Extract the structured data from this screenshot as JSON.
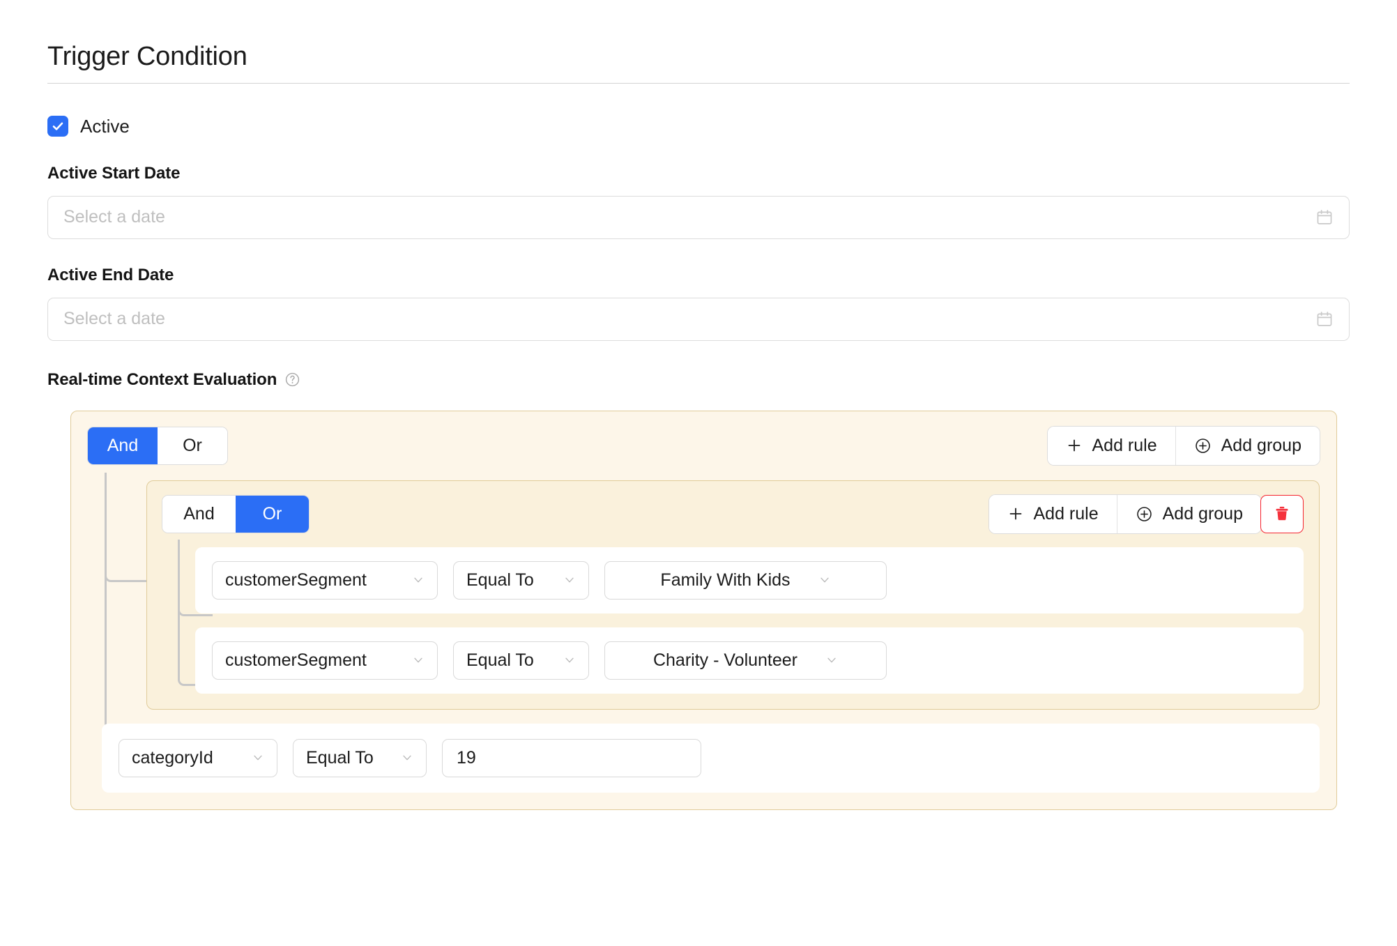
{
  "header": {
    "title": "Trigger Condition"
  },
  "active": {
    "label": "Active",
    "checked": true
  },
  "start_date": {
    "label": "Active Start Date",
    "placeholder": "Select a date",
    "value": ""
  },
  "end_date": {
    "label": "Active End Date",
    "placeholder": "Select a date",
    "value": ""
  },
  "rtce": {
    "label": "Real-time Context Evaluation",
    "help_icon": "question-circle-icon"
  },
  "builder": {
    "outer_group": {
      "combinator": {
        "and_label": "And",
        "or_label": "Or",
        "selected": "And"
      },
      "add_rule_label": "Add rule",
      "add_group_label": "Add group",
      "add_rule_icon": "plus-icon",
      "add_group_icon": "plus-circle-icon"
    },
    "inner_group": {
      "combinator": {
        "and_label": "And",
        "or_label": "Or",
        "selected": "Or"
      },
      "add_rule_label": "Add rule",
      "add_group_label": "Add group",
      "add_rule_icon": "plus-icon",
      "add_group_icon": "plus-circle-icon",
      "delete_icon": "trash-icon",
      "rules": [
        {
          "field": "customerSegment",
          "operator": "Equal To",
          "value": "Family With Kids",
          "value_type": "select"
        },
        {
          "field": "customerSegment",
          "operator": "Equal To",
          "value": "Charity - Volunteer",
          "value_type": "select"
        }
      ]
    },
    "outer_rules": [
      {
        "field": "categoryId",
        "operator": "Equal To",
        "value": "19",
        "value_type": "text"
      }
    ]
  },
  "colors": {
    "accent_blue": "#2b6ef5",
    "danger_red": "#f5222d",
    "group_bg_outer": "#fdf6e9",
    "group_bg_inner": "#faf1dc",
    "group_border": "#e0cb99",
    "tree_line": "#c7c7c7",
    "placeholder_text": "#bfbfbf"
  }
}
